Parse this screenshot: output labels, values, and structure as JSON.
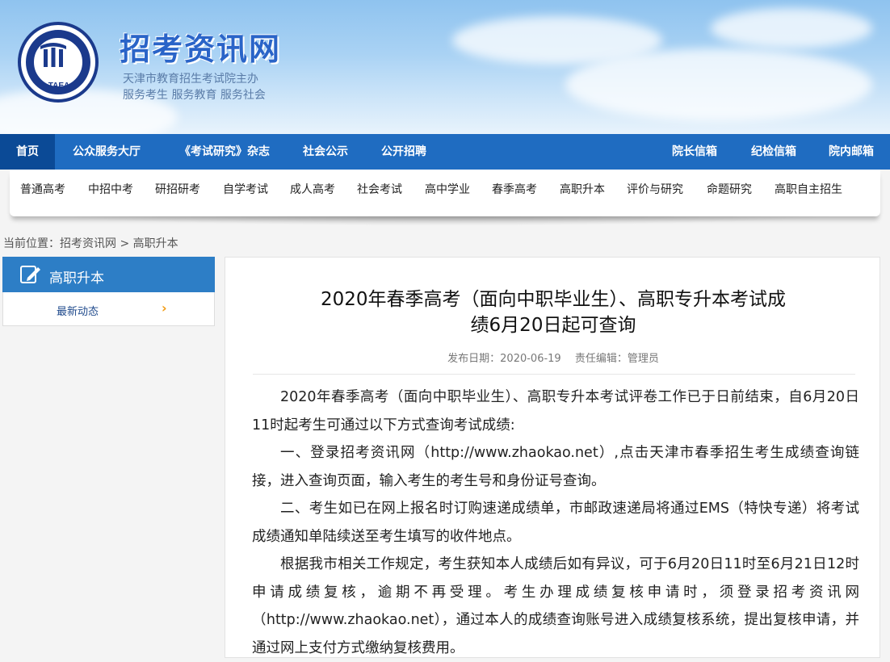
{
  "header": {
    "logo_text": "TAEA",
    "site_title": "招考资讯网",
    "sub_line1": "天津市教育招生考试院主办",
    "sub_line2": "服务考生 服务教育 服务社会"
  },
  "main_nav": [
    {
      "label": "首页"
    },
    {
      "label": "公众服务大厅"
    },
    {
      "label": "《考试研究》杂志"
    },
    {
      "label": "社会公示"
    },
    {
      "label": "公开招聘"
    },
    {
      "label": "院长信箱"
    },
    {
      "label": "纪检信箱"
    },
    {
      "label": "院内邮箱"
    }
  ],
  "sub_nav": [
    {
      "label": "普通高考"
    },
    {
      "label": "中招中考"
    },
    {
      "label": "研招研考"
    },
    {
      "label": "自学考试"
    },
    {
      "label": "成人高考"
    },
    {
      "label": "社会考试"
    },
    {
      "label": "高中学业"
    },
    {
      "label": "春季高考"
    },
    {
      "label": "高职升本"
    },
    {
      "label": "评价与研究"
    },
    {
      "label": "命题研究"
    },
    {
      "label": "高职自主招生"
    }
  ],
  "breadcrumb": "当前位置：招考资讯网 > 高职升本",
  "sidebar": {
    "title": "高职升本",
    "items": [
      {
        "label": "最新动态",
        "arrow": "›"
      }
    ]
  },
  "article": {
    "title_line1": "2020年春季高考（面向中职毕业生）、高职专升本考试成",
    "title_line2": "绩6月20日起可查询",
    "meta": "发布日期：2020-06-19　 责任编辑：管理员",
    "paragraphs": [
      "2020年春季高考（面向中职毕业生）、高职专升本考试评卷工作已于日前结束，自6月20日11时起考生可通过以下方式查询考试成绩:",
      "一、登录招考资讯网（http://www.zhaokao.net）,点击天津市春季招生考生成绩查询链接，进入查询页面，输入考生的考生号和身份证号查询。",
      "二、考生如已在网上报名时订购速递成绩单，市邮政速递局将通过EMS（特快专递）将考试成绩通知单陆续送至考生填写的收件地点。",
      "根据我市相关工作规定，考生获知本人成绩后如有异议，可于6月20日11时至6月21日12时申请成绩复核，逾期不再受理。考生办理成绩复核申请时，须登录招考资讯网（http://www.zhaokao.net），通过本人的成绩查询账号进入成绩复核系统，提出复核申请，并通过网上支付方式缴纳复核费用。"
    ]
  }
}
